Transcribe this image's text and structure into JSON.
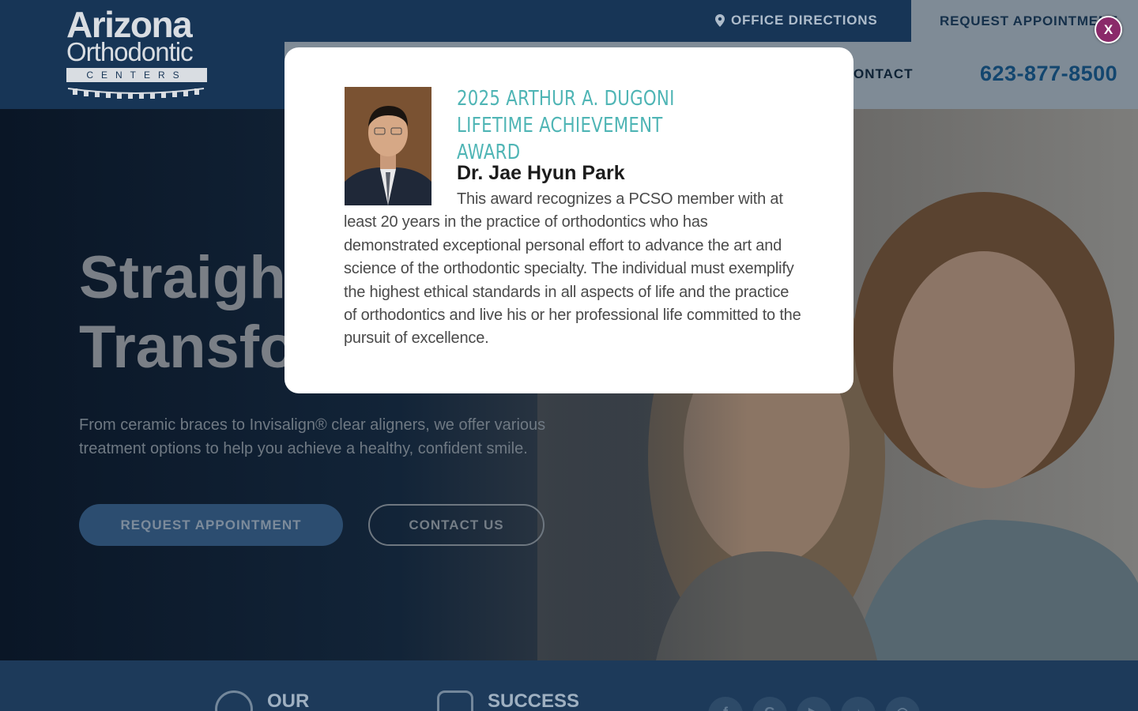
{
  "header": {
    "logo": {
      "line1": "Arizona",
      "line2": "Orthodontic",
      "line3": "CENTERS"
    },
    "office_directions": "OFFICE DIRECTIONS",
    "request_appointment": "REQUEST APPOINTMENT",
    "nav_contact": "ONTACT",
    "phone": "623-877-8500"
  },
  "hero": {
    "title_line1": "Straight",
    "title_line2": "Transfo",
    "subtitle": "From ceramic braces to Invisalign® clear aligners, we offer various treatment options to help you achieve a healthy, confident smile.",
    "request_button": "REQUEST APPOINTMENT",
    "contact_button": "CONTACT US"
  },
  "bottom_bar": {
    "item1": "OUR",
    "item2": "SUCCESS"
  },
  "modal": {
    "award_title": "2025 ARTHUR A. DUGONI LIFETIME ACHIEVEMENT AWARD",
    "name": "Dr. Jae Hyun Park",
    "body": "This award recognizes a PCSO member with at least 20 years in the practice of orthodontics who has demonstrated exceptional personal effort to advance the art and science of the orthodontic specialty. The individual must exemplify the highest ethical standards in all aspects of life and the practice of orthodontics and live his or her professional life committed to the pursuit of excellence.",
    "close_label": "X"
  },
  "colors": {
    "header_bg": "#173556",
    "accent_teal": "#4fb5b5",
    "close_button": "#8a2a6a",
    "phone_blue": "#13466f"
  }
}
